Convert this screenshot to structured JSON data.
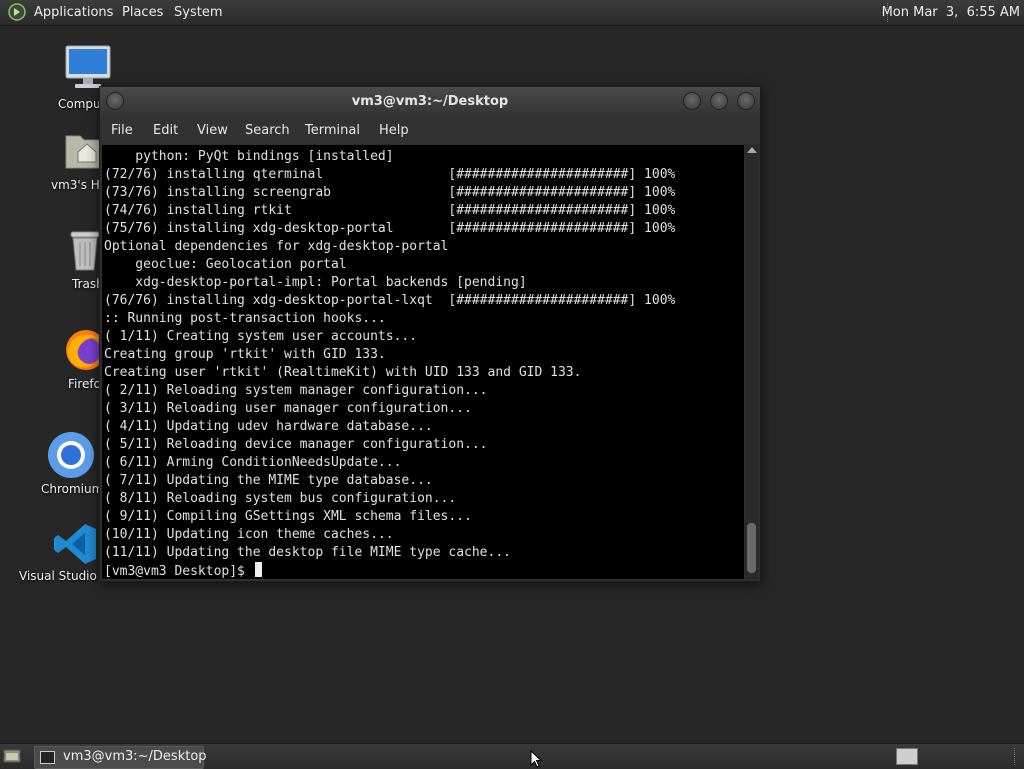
{
  "top_panel": {
    "menus": [
      "Applications",
      "Places",
      "System"
    ],
    "clock": "Mon Mar  3,  6:55 AM"
  },
  "desktop_icons": [
    {
      "name": "computer",
      "label": "Compu",
      "icon": "computer-icon"
    },
    {
      "name": "home",
      "label": "vm3's H",
      "icon": "home-folder-icon"
    },
    {
      "name": "trash",
      "label": "Trash",
      "icon": "trash-icon"
    },
    {
      "name": "firefox",
      "label": "Firefo",
      "icon": "firefox-icon"
    },
    {
      "name": "chromium",
      "label": "Chromium",
      "icon": "chromium-icon"
    },
    {
      "name": "vscode",
      "label": "Visual Studio Code",
      "icon": "vscode-icon"
    }
  ],
  "terminal": {
    "title": "vm3@vm3:~/Desktop",
    "menu": [
      "File",
      "Edit",
      "View",
      "Search",
      "Terminal",
      "Help"
    ],
    "lines": [
      "    python: PyQt bindings [installed]",
      "(72/76) installing qterminal                [######################] 100%",
      "(73/76) installing screengrab               [######################] 100%",
      "(74/76) installing rtkit                    [######################] 100%",
      "(75/76) installing xdg-desktop-portal       [######################] 100%",
      "Optional dependencies for xdg-desktop-portal",
      "    geoclue: Geolocation portal",
      "    xdg-desktop-portal-impl: Portal backends [pending]",
      "(76/76) installing xdg-desktop-portal-lxqt  [######################] 100%",
      ":: Running post-transaction hooks...",
      "( 1/11) Creating system user accounts...",
      "Creating group 'rtkit' with GID 133.",
      "Creating user 'rtkit' (RealtimeKit) with UID 133 and GID 133.",
      "( 2/11) Reloading system manager configuration...",
      "( 3/11) Reloading user manager configuration...",
      "( 4/11) Updating udev hardware database...",
      "( 5/11) Reloading device manager configuration...",
      "( 6/11) Arming ConditionNeedsUpdate...",
      "( 7/11) Updating the MIME type database...",
      "( 8/11) Reloading system bus configuration...",
      "( 9/11) Compiling GSettings XML schema files...",
      "(10/11) Updating icon theme caches...",
      "(11/11) Updating the desktop file MIME type cache..."
    ],
    "prompt": "[vm3@vm3 Desktop]$ "
  },
  "taskbar": {
    "window_label": "vm3@vm3:~/Desktop"
  },
  "colors": {
    "desktop_bg": "#272727",
    "terminal_bg": "#000000",
    "terminal_fg": "#e0e0e0"
  }
}
